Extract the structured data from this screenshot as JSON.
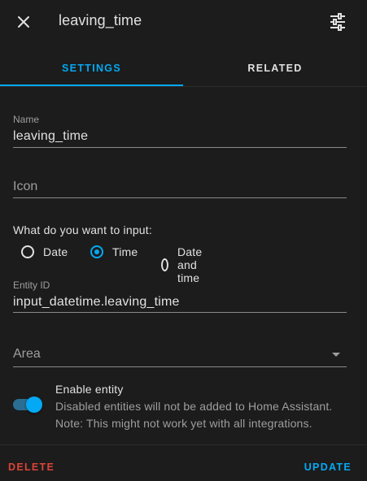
{
  "header": {
    "title": "leaving_time",
    "close_icon": "close-icon",
    "settings_icon": "tune-icon"
  },
  "tabs": [
    {
      "label": "SETTINGS",
      "active": true
    },
    {
      "label": "RELATED",
      "active": false
    }
  ],
  "form": {
    "name": {
      "label": "Name",
      "value": "leaving_time"
    },
    "icon": {
      "placeholder": "Icon"
    },
    "input_question": "What do you want to input:",
    "input_options": [
      {
        "label": "Date",
        "checked": false
      },
      {
        "label": "Time",
        "checked": true
      },
      {
        "label": "Date and time",
        "checked": false
      }
    ],
    "entity_id": {
      "label": "Entity ID",
      "value": "input_datetime.leaving_time"
    },
    "area": {
      "placeholder": "Area"
    },
    "enable": {
      "title": "Enable entity",
      "description_line1": "Disabled entities will not be added to Home Assistant.",
      "description_line2": "Note: This might not work yet with all integrations.",
      "enabled": true
    }
  },
  "footer": {
    "delete_label": "DELETE",
    "update_label": "UPDATE"
  },
  "colors": {
    "accent": "#03a9f4",
    "danger": "#db4437",
    "background": "#1c1c1c"
  }
}
